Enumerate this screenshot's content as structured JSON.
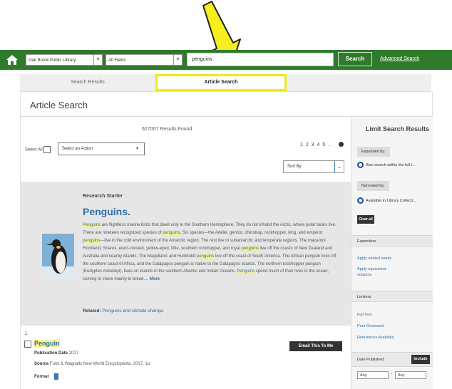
{
  "topbar": {
    "library_select": "Oak Brook Public Library",
    "field_select": "All Fields",
    "search_value": "penguins",
    "search_button": "Search",
    "advanced_link": "Advanced Search"
  },
  "tabs": [
    {
      "label": "Search Results"
    },
    {
      "label": "Article Search"
    }
  ],
  "page_title": "Article Search",
  "results_count": "627007 Results Found",
  "select_all_label": "Select All",
  "action_select": "Select an Action",
  "pager": "1 2 3 4 5 ..",
  "sort_select": "Sort By:",
  "research_starter": {
    "label": "Research Starter",
    "title": "Penguins.",
    "text_parts": [
      {
        "t": "Penguins",
        "hl": true
      },
      {
        "t": " are flightless marine birds that dwell only in the Southern Hemisphere. They do not inhabit the Arctic, where polar bears live. There are nineteen recognized species of ",
        "hl": false
      },
      {
        "t": "penguins",
        "hl": true
      },
      {
        "t": ". Six species—the Adélie, gentoo, chinstrap, rockhopper, king, and emperor ",
        "hl": false
      },
      {
        "t": "penguins",
        "hl": true
      },
      {
        "t": "—live in the cold environment of the Antarctic region. The rest live in subantarctic and temperate regions. The macaroni, Fiordland, Snares, erect-crested, yellow-eyed, little, southern rockhopper, and royal ",
        "hl": false
      },
      {
        "t": "penguins",
        "hl": true
      },
      {
        "t": " live off the coasts of New Zealand and Australia and nearby islands. The Magellanic and Humboldt ",
        "hl": false
      },
      {
        "t": "penguins",
        "hl": true
      },
      {
        "t": " live off the coast of South America. The African penguin lives off the southern coast of Africa, and the Galápagos penguin is native to the Galápagos Islands. The northern rockhopper penguin (Eudyptes moseleyi), lives on islands in the southern Atlantic and Indian Oceans. ",
        "hl": false
      },
      {
        "t": "Penguins",
        "hl": true
      },
      {
        "t": " spend much of their lives in the ocean, coming to shore mainly to breed.... ",
        "hl": false
      }
    ],
    "more": "More",
    "related_label": "Related:",
    "related_link": "Penguins and climate change."
  },
  "result": {
    "number": "1.",
    "title": "Penguin",
    "pub_date_label": "Publication Date",
    "pub_date": "2017",
    "source_label": "Source",
    "source": "Funk & Wagnalls New World Encyclopedia, 2017, 1p.",
    "format_label": "Format",
    "email_button": "Email This To Me"
  },
  "sidebar": {
    "title": "Limit Search Results",
    "expanded_by": "Expanded by:",
    "expanded_option": "Also search within the full t...",
    "narrowed_by": "Narrowed by:",
    "narrowed_option": "Available in Library Collecti...",
    "clear_all": "Clear all",
    "expanders_header": "Expanders",
    "expander_links": [
      "Apply related words",
      "Apply equivalent subjects"
    ],
    "limiters_header": "Limiters",
    "limiter_links": [
      "Full Text",
      "Peer Reviewed",
      "References Available"
    ],
    "date_published": "Date Published",
    "include_button": "Include",
    "date_from": "Any",
    "date_to": "Any"
  },
  "colors": {
    "topbar_green": "#2f7a2b",
    "highlight_yellow": "#f2ea1b",
    "link_blue": "#2f6fa8"
  }
}
